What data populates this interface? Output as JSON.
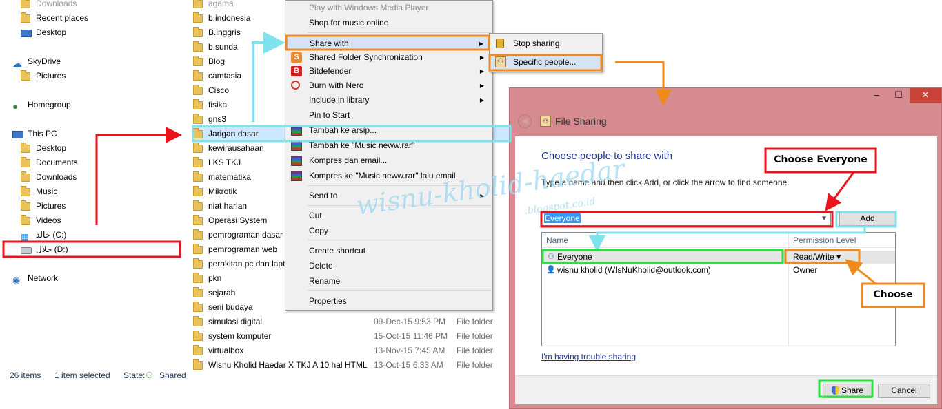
{
  "navigation": {
    "items": [
      {
        "label": "Downloads",
        "icon": "folder-icon",
        "indent": 1
      },
      {
        "label": "Recent places",
        "icon": "folder-icon",
        "indent": 1
      },
      {
        "label": "Desktop",
        "icon": "desktop-icon",
        "indent": 1
      },
      {
        "label": "SkyDrive",
        "icon": "skydrive-icon",
        "indent": 0
      },
      {
        "label": "Pictures",
        "icon": "folder-icon",
        "indent": 1
      },
      {
        "label": "Homegroup",
        "icon": "homegroup-icon",
        "indent": 0
      },
      {
        "label": "This PC",
        "icon": "pc-icon",
        "indent": 0
      },
      {
        "label": "Desktop",
        "icon": "folder-icon",
        "indent": 1
      },
      {
        "label": "Documents",
        "icon": "folder-icon",
        "indent": 1
      },
      {
        "label": "Downloads",
        "icon": "folder-icon",
        "indent": 1
      },
      {
        "label": "Music",
        "icon": "folder-icon",
        "indent": 1
      },
      {
        "label": "Pictures",
        "icon": "folder-icon",
        "indent": 1
      },
      {
        "label": "Videos",
        "icon": "folder-icon",
        "indent": 1
      },
      {
        "label": "خالد (C:)",
        "icon": "windows-drive-icon",
        "indent": 1
      },
      {
        "label": "حلال (D:)",
        "icon": "drive-icon",
        "indent": 1
      },
      {
        "label": "Network",
        "icon": "network-icon",
        "indent": 0
      }
    ]
  },
  "files": [
    {
      "name": "agama",
      "date": "",
      "type": ""
    },
    {
      "name": "b.indonesia",
      "date": "",
      "type": ""
    },
    {
      "name": "B.inggris",
      "date": "",
      "type": ""
    },
    {
      "name": "b.sunda",
      "date": "",
      "type": ""
    },
    {
      "name": "Blog",
      "date": "",
      "type": ""
    },
    {
      "name": "camtasia",
      "date": "",
      "type": ""
    },
    {
      "name": "Cisco",
      "date": "",
      "type": ""
    },
    {
      "name": "fisika",
      "date": "",
      "type": ""
    },
    {
      "name": "gns3",
      "date": "",
      "type": ""
    },
    {
      "name": "Jarigan dasar",
      "date": "",
      "type": "",
      "selected": true
    },
    {
      "name": "kewirausahaan",
      "date": "",
      "type": ""
    },
    {
      "name": "LKS TKJ",
      "date": "",
      "type": ""
    },
    {
      "name": "matematika",
      "date": "",
      "type": ""
    },
    {
      "name": "Mikrotik",
      "date": "",
      "type": ""
    },
    {
      "name": "niat harian",
      "date": "",
      "type": ""
    },
    {
      "name": "Operasi System",
      "date": "",
      "type": ""
    },
    {
      "name": "pemrograman dasar",
      "date": "",
      "type": ""
    },
    {
      "name": "pemrograman web",
      "date": "",
      "type": ""
    },
    {
      "name": "perakitan pc dan lapt",
      "date": "",
      "type": ""
    },
    {
      "name": "pkn",
      "date": "",
      "type": ""
    },
    {
      "name": "sejarah",
      "date": "",
      "type": ""
    },
    {
      "name": "seni budaya",
      "date": "",
      "type": ""
    },
    {
      "name": "simulasi digital",
      "date": "09-Dec-15 9:53 PM",
      "type": "File folder"
    },
    {
      "name": "system komputer",
      "date": "15-Oct-15 11:46 PM",
      "type": "File folder"
    },
    {
      "name": "virtualbox",
      "date": "13-Nov-15 7:45 AM",
      "type": "File folder"
    },
    {
      "name": "Wisnu Kholid Haedar X TKJ A 10 hal HTML",
      "date": "13-Oct-15 6:33 AM",
      "type": "File folder"
    }
  ],
  "statusbar": {
    "count": "26 items",
    "selected": "1 item selected",
    "state_label": "State:",
    "state_value": "Shared"
  },
  "context_menu": {
    "items": [
      {
        "label": "Play with Windows Media Player",
        "disabled": true
      },
      {
        "label": "Shop for music online"
      },
      {
        "label": "Share with",
        "submenu": true,
        "highlighted": true
      },
      {
        "label": "Shared Folder Synchronization",
        "icon": "sync-icon",
        "submenu": true
      },
      {
        "label": "Bitdefender",
        "icon": "bitdefender-icon",
        "submenu": true
      },
      {
        "label": "Burn with Nero",
        "icon": "nero-icon",
        "submenu": true
      },
      {
        "label": "Include in library",
        "submenu": true
      },
      {
        "label": "Pin to Start"
      },
      {
        "label": "Tambah ke arsip...",
        "icon": "winrar-icon"
      },
      {
        "label": "Tambah ke \"Music neww.rar\"",
        "icon": "winrar-icon"
      },
      {
        "label": "Kompres dan email...",
        "icon": "winrar-icon"
      },
      {
        "label": "Kompres ke \"Music neww.rar\" lalu email",
        "icon": "winrar-icon"
      },
      {
        "label": "Send to",
        "submenu": true
      },
      {
        "label": "Cut"
      },
      {
        "label": "Copy"
      },
      {
        "label": "Create shortcut"
      },
      {
        "label": "Delete"
      },
      {
        "label": "Rename"
      },
      {
        "label": "Properties"
      }
    ]
  },
  "share_submenu": {
    "stop_sharing": "Stop sharing",
    "specific_people": "Specific people..."
  },
  "dialog": {
    "title": "File Sharing",
    "heading": "Choose people to share with",
    "instruction": "Type a name and then click Add, or click the arrow to find someone.",
    "input_value": "Everyone",
    "add_label": "Add",
    "col_name": "Name",
    "col_permission": "Permission Level",
    "rows": [
      {
        "name": "Everyone",
        "permission": "Read/Write ▾"
      },
      {
        "name": "wisnu kholid (WIsNuKholid@outlook.com)",
        "permission": "Owner"
      }
    ],
    "trouble_link": "I'm having trouble sharing",
    "share_label": "Share",
    "cancel_label": "Cancel"
  },
  "annotations": {
    "choose_everyone": "Choose Everyone",
    "choose": "Choose",
    "watermark": "wisnu-kholid-haedar",
    "watermark_sub": ".blogspot.co.id"
  },
  "colors": {
    "red": "#e8161c",
    "orange": "#f08a1c",
    "cyan": "#7fe3ee",
    "green": "#27e23c",
    "dialog_frame": "#d58b8f"
  }
}
